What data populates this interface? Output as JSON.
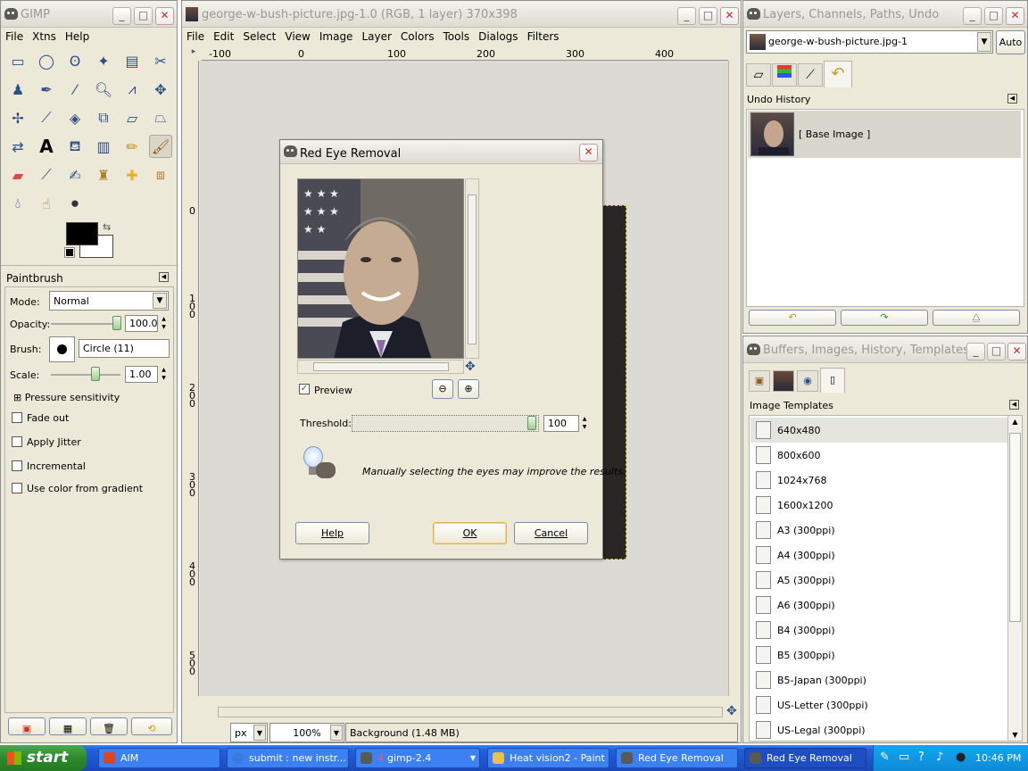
{
  "toolbox": {
    "title": "GIMP",
    "menu": [
      "File",
      "Xtns",
      "Help"
    ],
    "paintbrush_title": "Paintbrush",
    "mode_label": "Mode:",
    "mode_value": "Normal",
    "opacity_label": "Opacity:",
    "opacity_value": "100.0",
    "brush_label": "Brush:",
    "brush_value": "Circle (11)",
    "scale_label": "Scale:",
    "scale_value": "1.00",
    "pressure_label": "Pressure sensitivity",
    "options": [
      "Fade out",
      "Apply Jitter",
      "Incremental",
      "Use color from gradient"
    ]
  },
  "image_window": {
    "title": "george-w-bush-picture.jpg-1.0 (RGB, 1 layer) 370x398",
    "menu": [
      "File",
      "Edit",
      "Select",
      "View",
      "Image",
      "Layer",
      "Colors",
      "Tools",
      "Dialogs",
      "Filters"
    ],
    "ruler_h": [
      "-100",
      "0",
      "100",
      "200",
      "300",
      "400"
    ],
    "ruler_v": [
      "0",
      "100",
      "200",
      "300",
      "400",
      "500"
    ],
    "unit": "px",
    "zoom": "100%",
    "status": "Background (1.48 MB)"
  },
  "dialog": {
    "title": "Red Eye Removal",
    "preview_label": "Preview",
    "threshold_label": "Threshold:",
    "threshold_value": "100",
    "hint": "Manually selecting the eyes may improve the results.",
    "help_button": "Help",
    "ok_button": "OK",
    "cancel_button": "Cancel"
  },
  "layers_window": {
    "title": "Layers, Channels, Paths, Undo",
    "image_select": "george-w-bush-picture.jpg-1",
    "auto_button": "Auto",
    "undo_title": "Undo History",
    "undo_item": "[ Base Image ]"
  },
  "buffers_window": {
    "title": "Buffers, Images, History, Templates",
    "panel_title": "Image Templates",
    "templates": [
      "640x480",
      "800x600",
      "1024x768",
      "1600x1200",
      "A3 (300ppi)",
      "A4 (300ppi)",
      "A5 (300ppi)",
      "A6 (300ppi)",
      "B4 (300ppi)",
      "B5 (300ppi)",
      "B5-Japan (300ppi)",
      "US-Letter (300ppi)",
      "US-Legal (300ppi)"
    ]
  },
  "taskbar": {
    "start": "start",
    "tasks": [
      "AIM",
      "submit : new instr...",
      "gimp-2.4",
      "Heat vision2 - Paint",
      "Red Eye Removal",
      "Red Eye Removal"
    ],
    "gimp_count": "4",
    "clock": "10:46 PM"
  },
  "icons": [
    "gimp-icon",
    "rect-select-icon",
    "ellipse-select-icon",
    "lasso-icon",
    "magic-wand-icon",
    "color-select-icon",
    "scissors-icon",
    "paintbrush-icon",
    "lightbulb-icon",
    "undo-icon",
    "zoom-in-icon",
    "zoom-out-icon",
    "navigate-icon"
  ]
}
